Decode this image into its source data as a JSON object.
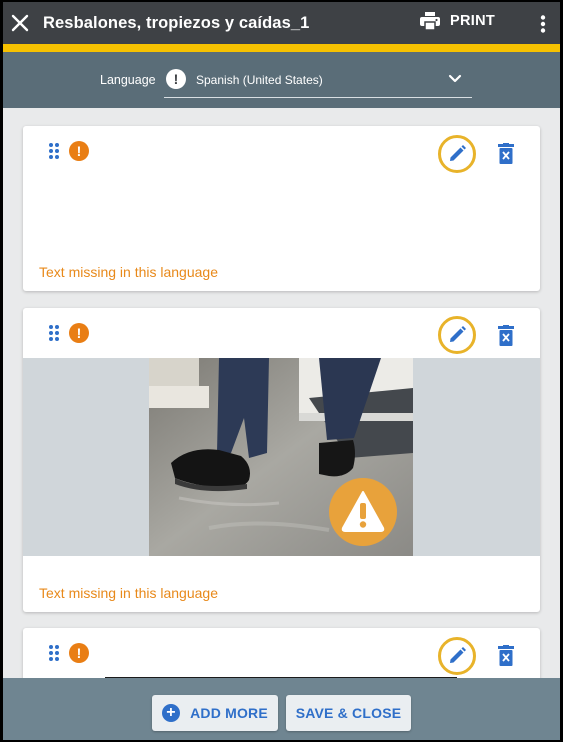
{
  "appbar": {
    "title": "Resbalones, tropiezos y caídas_1",
    "print_label": "PRINT"
  },
  "language": {
    "label": "Language",
    "selected": "Spanish (United States)"
  },
  "cards": [
    {
      "missing_text": "Text missing in this language",
      "has_image": false
    },
    {
      "missing_text": "Text missing in this language",
      "has_image": true,
      "image_icon": "warning-triangle-icon"
    },
    {
      "missing_text": "",
      "has_image": false
    }
  ],
  "footer": {
    "add_more": "ADD MORE",
    "save_close": "SAVE & CLOSE"
  },
  "colors": {
    "appbar": "#3e4145",
    "accent": "#f6c100",
    "langbar": "#5a6d78",
    "footer": "#6f8591",
    "primary": "#2f6fc9",
    "warning": "#e97e14",
    "highlight_ring": "#e8b32a"
  }
}
